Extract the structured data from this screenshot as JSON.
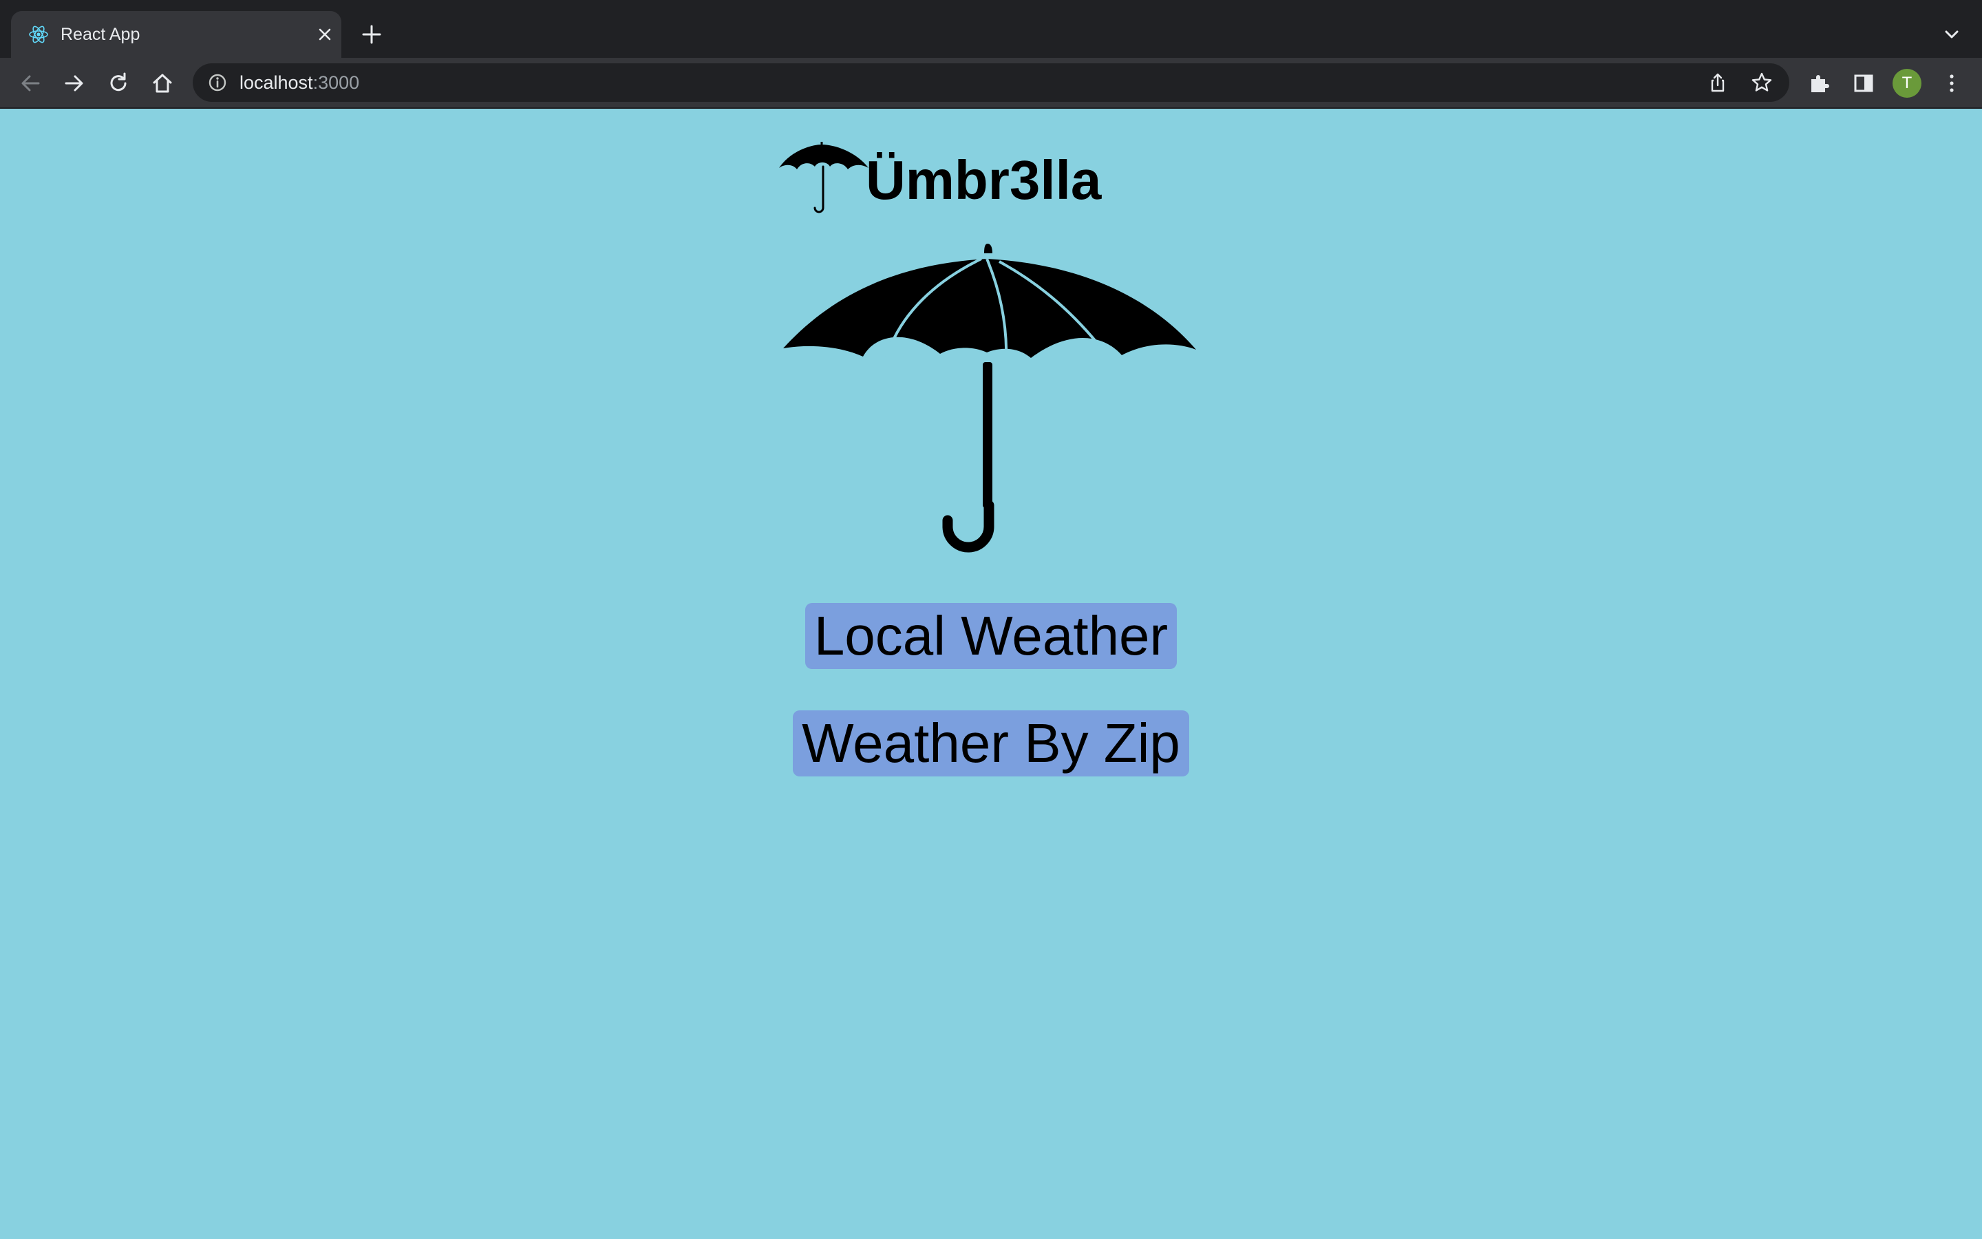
{
  "browser": {
    "tab_title": "React App",
    "url_host": "localhost",
    "url_port": ":3000",
    "profile_initial": "T",
    "profile_color": "#6a9a3a"
  },
  "app": {
    "title": "Ümbr3lla",
    "background_color": "#88d1e0",
    "button_color": "#7b9fde",
    "buttons": {
      "local_weather": "Local Weather",
      "weather_by_zip": "Weather By Zip"
    }
  },
  "icons": {
    "tab_favicon": "react-logo-icon",
    "header_logo": "umbrella-icon",
    "hero_image": "umbrella-icon"
  }
}
